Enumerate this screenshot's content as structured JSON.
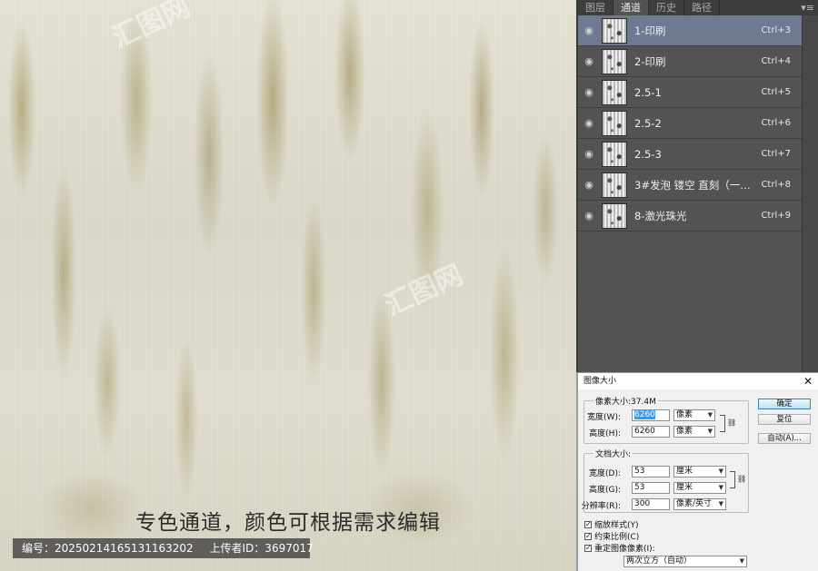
{
  "canvas": {
    "caption": "专色通道，颜色可根据需求编辑",
    "id_label": "编号：20250214165131163202",
    "uploader_label": "上传者ID：3697017",
    "watermark": "汇图网"
  },
  "channels_panel": {
    "tabs": [
      "图层",
      "通道",
      "历史",
      "路径"
    ],
    "active_tab": "通道",
    "menu_icon": "panel-menu-icon",
    "rows": [
      {
        "name": "1-印刷",
        "shortcut": "Ctrl+3",
        "selected": true
      },
      {
        "name": "2-印刷",
        "shortcut": "Ctrl+4",
        "selected": false
      },
      {
        "name": "2.5-1",
        "shortcut": "Ctrl+5",
        "selected": false
      },
      {
        "name": "2.5-2",
        "shortcut": "Ctrl+6",
        "selected": false
      },
      {
        "name": "2.5-3",
        "shortcut": "Ctrl+7",
        "selected": false
      },
      {
        "name": "3#发泡 镂空   直刻（一…",
        "shortcut": "Ctrl+8",
        "selected": false
      },
      {
        "name": "8-激光珠光",
        "shortcut": "Ctrl+9",
        "selected": false
      }
    ]
  },
  "image_size_dialog": {
    "title": "图像大小",
    "pixel_dimensions": {
      "legend": "像素大小:37.4M",
      "width_label": "宽度(W):",
      "width_value": "6260",
      "width_unit": "像素",
      "height_label": "高度(H):",
      "height_value": "6260",
      "height_unit": "像素"
    },
    "document_size": {
      "legend": "文档大小:",
      "width_label": "宽度(D):",
      "width_value": "53",
      "width_unit": "厘米",
      "height_label": "高度(G):",
      "height_value": "53",
      "height_unit": "厘米",
      "resolution_label": "分辨率(R):",
      "resolution_value": "300",
      "resolution_unit": "像素/英寸"
    },
    "buttons": {
      "ok": "确定",
      "reset": "复位",
      "auto": "自动(A)..."
    },
    "checkboxes": [
      {
        "label": "缩放样式(Y)",
        "checked": true
      },
      {
        "label": "约束比例(C)",
        "checked": true
      },
      {
        "label": "重定图像像素(I):",
        "checked": true
      }
    ],
    "resample_method": "两次立方（自动）"
  }
}
